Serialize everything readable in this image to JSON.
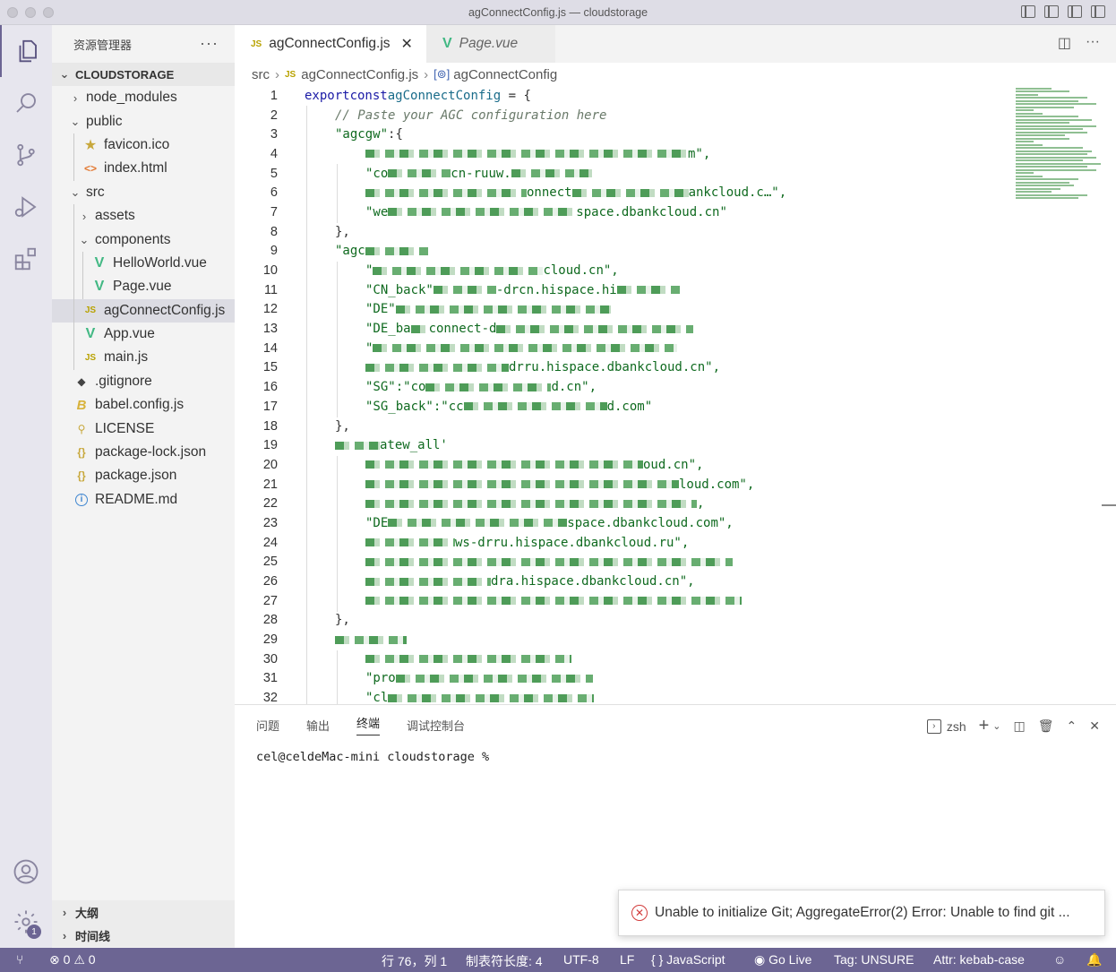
{
  "window": {
    "title": "agConnectConfig.js — cloudstorage"
  },
  "activity": [
    "explorer-icon",
    "search-icon",
    "source-control-icon",
    "run-debug-icon",
    "extensions-icon",
    "account-icon",
    "settings-icon"
  ],
  "settings_badge": "1",
  "sidebar": {
    "header": "资源管理器",
    "more": "···",
    "section": "CLOUDSTORAGE",
    "tree": [
      {
        "label": "node_modules",
        "icon": "chevron-right",
        "depth": 0
      },
      {
        "label": "public",
        "icon": "chevron-down",
        "depth": 0
      },
      {
        "label": "favicon.ico",
        "icon": "star",
        "depth": 1
      },
      {
        "label": "index.html",
        "icon": "html",
        "depth": 1
      },
      {
        "label": "src",
        "icon": "chevron-down",
        "depth": 0
      },
      {
        "label": "assets",
        "icon": "chevron-right",
        "depth": 1
      },
      {
        "label": "components",
        "icon": "chevron-down",
        "depth": 1
      },
      {
        "label": "HelloWorld.vue",
        "icon": "vue",
        "depth": 2
      },
      {
        "label": "Page.vue",
        "icon": "vue",
        "depth": 2
      },
      {
        "label": "agConnectConfig.js",
        "icon": "js",
        "depth": 1,
        "selected": true
      },
      {
        "label": "App.vue",
        "icon": "vue",
        "depth": 1
      },
      {
        "label": "main.js",
        "icon": "js",
        "depth": 1
      },
      {
        "label": ".gitignore",
        "icon": "git",
        "depth": 0
      },
      {
        "label": "babel.config.js",
        "icon": "babel",
        "depth": 0
      },
      {
        "label": "LICENSE",
        "icon": "license",
        "depth": 0
      },
      {
        "label": "package-lock.json",
        "icon": "json",
        "depth": 0
      },
      {
        "label": "package.json",
        "icon": "json",
        "depth": 0
      },
      {
        "label": "README.md",
        "icon": "info",
        "depth": 0
      }
    ],
    "outline": "大纲",
    "timeline": "时间线"
  },
  "tabs": [
    {
      "label": "agConnectConfig.js",
      "icon": "JS",
      "active": true,
      "close": "✕"
    },
    {
      "label": "Page.vue",
      "icon": "V",
      "active": false
    }
  ],
  "breadcrumb": {
    "root": "src",
    "file": "agConnectConfig.js",
    "file_icon": "JS",
    "symbol_icon": "[⊚]",
    "symbol": "agConnectConfig"
  },
  "code": [
    {
      "n": "1"
    },
    {
      "n": "2"
    },
    {
      "n": "3"
    },
    {
      "n": "4"
    },
    {
      "n": "5"
    },
    {
      "n": "6"
    },
    {
      "n": "7"
    },
    {
      "n": "8"
    },
    {
      "n": "9"
    },
    {
      "n": "10"
    },
    {
      "n": "11"
    },
    {
      "n": "12"
    },
    {
      "n": "13"
    },
    {
      "n": "14"
    },
    {
      "n": "15"
    },
    {
      "n": "16"
    },
    {
      "n": "17"
    },
    {
      "n": "18"
    },
    {
      "n": "19"
    },
    {
      "n": "20"
    },
    {
      "n": "21"
    },
    {
      "n": "22"
    },
    {
      "n": "23"
    },
    {
      "n": "24"
    },
    {
      "n": "25"
    },
    {
      "n": "26"
    },
    {
      "n": "27"
    },
    {
      "n": "28"
    },
    {
      "n": "29"
    },
    {
      "n": "30"
    },
    {
      "n": "31"
    },
    {
      "n": "32"
    }
  ],
  "code_text": {
    "l1_kw1": "export",
    "l1_kw2": "const",
    "l1_name": "agConnectConfig",
    "l1_rest": " = {",
    "l2": "// Paste your AGC configuration here",
    "l3_key": "\"agcgw\"",
    "l3_rest": ":{",
    "l4_tail": "m\",",
    "l5_a": "\"co",
    "l5_b": "cn-ruuw.",
    "l6_a": "onnect",
    "l6_b": "ankcloud.c…\",",
    "l7_a": "\"we",
    "l7_b": "space.dbankcloud.cn\"",
    "l8": "},",
    "l9_a": "\"agc",
    "l10_a": "\"",
    "l10_b": "cloud.cn\",",
    "l11_a": "\"CN_back\"",
    "l11_b": "-drcn.hispace.hi",
    "l12_a": "\"DE\"",
    "l13_a": "\"DE_ba",
    "l13_b": "connect-d",
    "l14_a": "\"",
    "l15_b": "drru.hispace.dbankcloud.cn\",",
    "l16_a": "\"SG\":\"co",
    "l16_b": "d.cn\",",
    "l17_a": "\"SG_back\":\"cc",
    "l17_b": "d.com\"",
    "l18": "},",
    "l19_a": "atew_all'",
    "l20_b": "oud.cn\",",
    "l21_b": "loud.com\",",
    "l22_b": ",",
    "l23_a": "\"DE",
    "l23_b": "space.dbankcloud.com\",",
    "l24_b": "ws-drru.hispace.dbankcloud.ru\",",
    "l26_b": "dra.hispace.dbankcloud.cn\",",
    "l28": "},",
    "l31_a": "\"pro",
    "l32_a": "\"cl"
  },
  "panel": {
    "tabs": [
      "问题",
      "输出",
      "终端",
      "调试控制台"
    ],
    "active_tab": "终端",
    "shell": "zsh",
    "prompt": "cel@celdeMac-mini cloudstorage %"
  },
  "notification": {
    "message": "Unable to initialize Git; AggregateError(2) Error: Unable to find git ..."
  },
  "statusbar": {
    "errors": "0",
    "warnings": "0",
    "position": "行 76，列 1",
    "tab_size": "制表符长度: 4",
    "encoding": "UTF-8",
    "eol": "LF",
    "language": "JavaScript",
    "go_live": "Go Live",
    "tag": "Tag: UNSURE",
    "attr": "Attr: kebab-case"
  },
  "colors": {
    "accent": "#6c6593",
    "string": "#0f6a1f",
    "keyword": "#1a1aa6"
  }
}
